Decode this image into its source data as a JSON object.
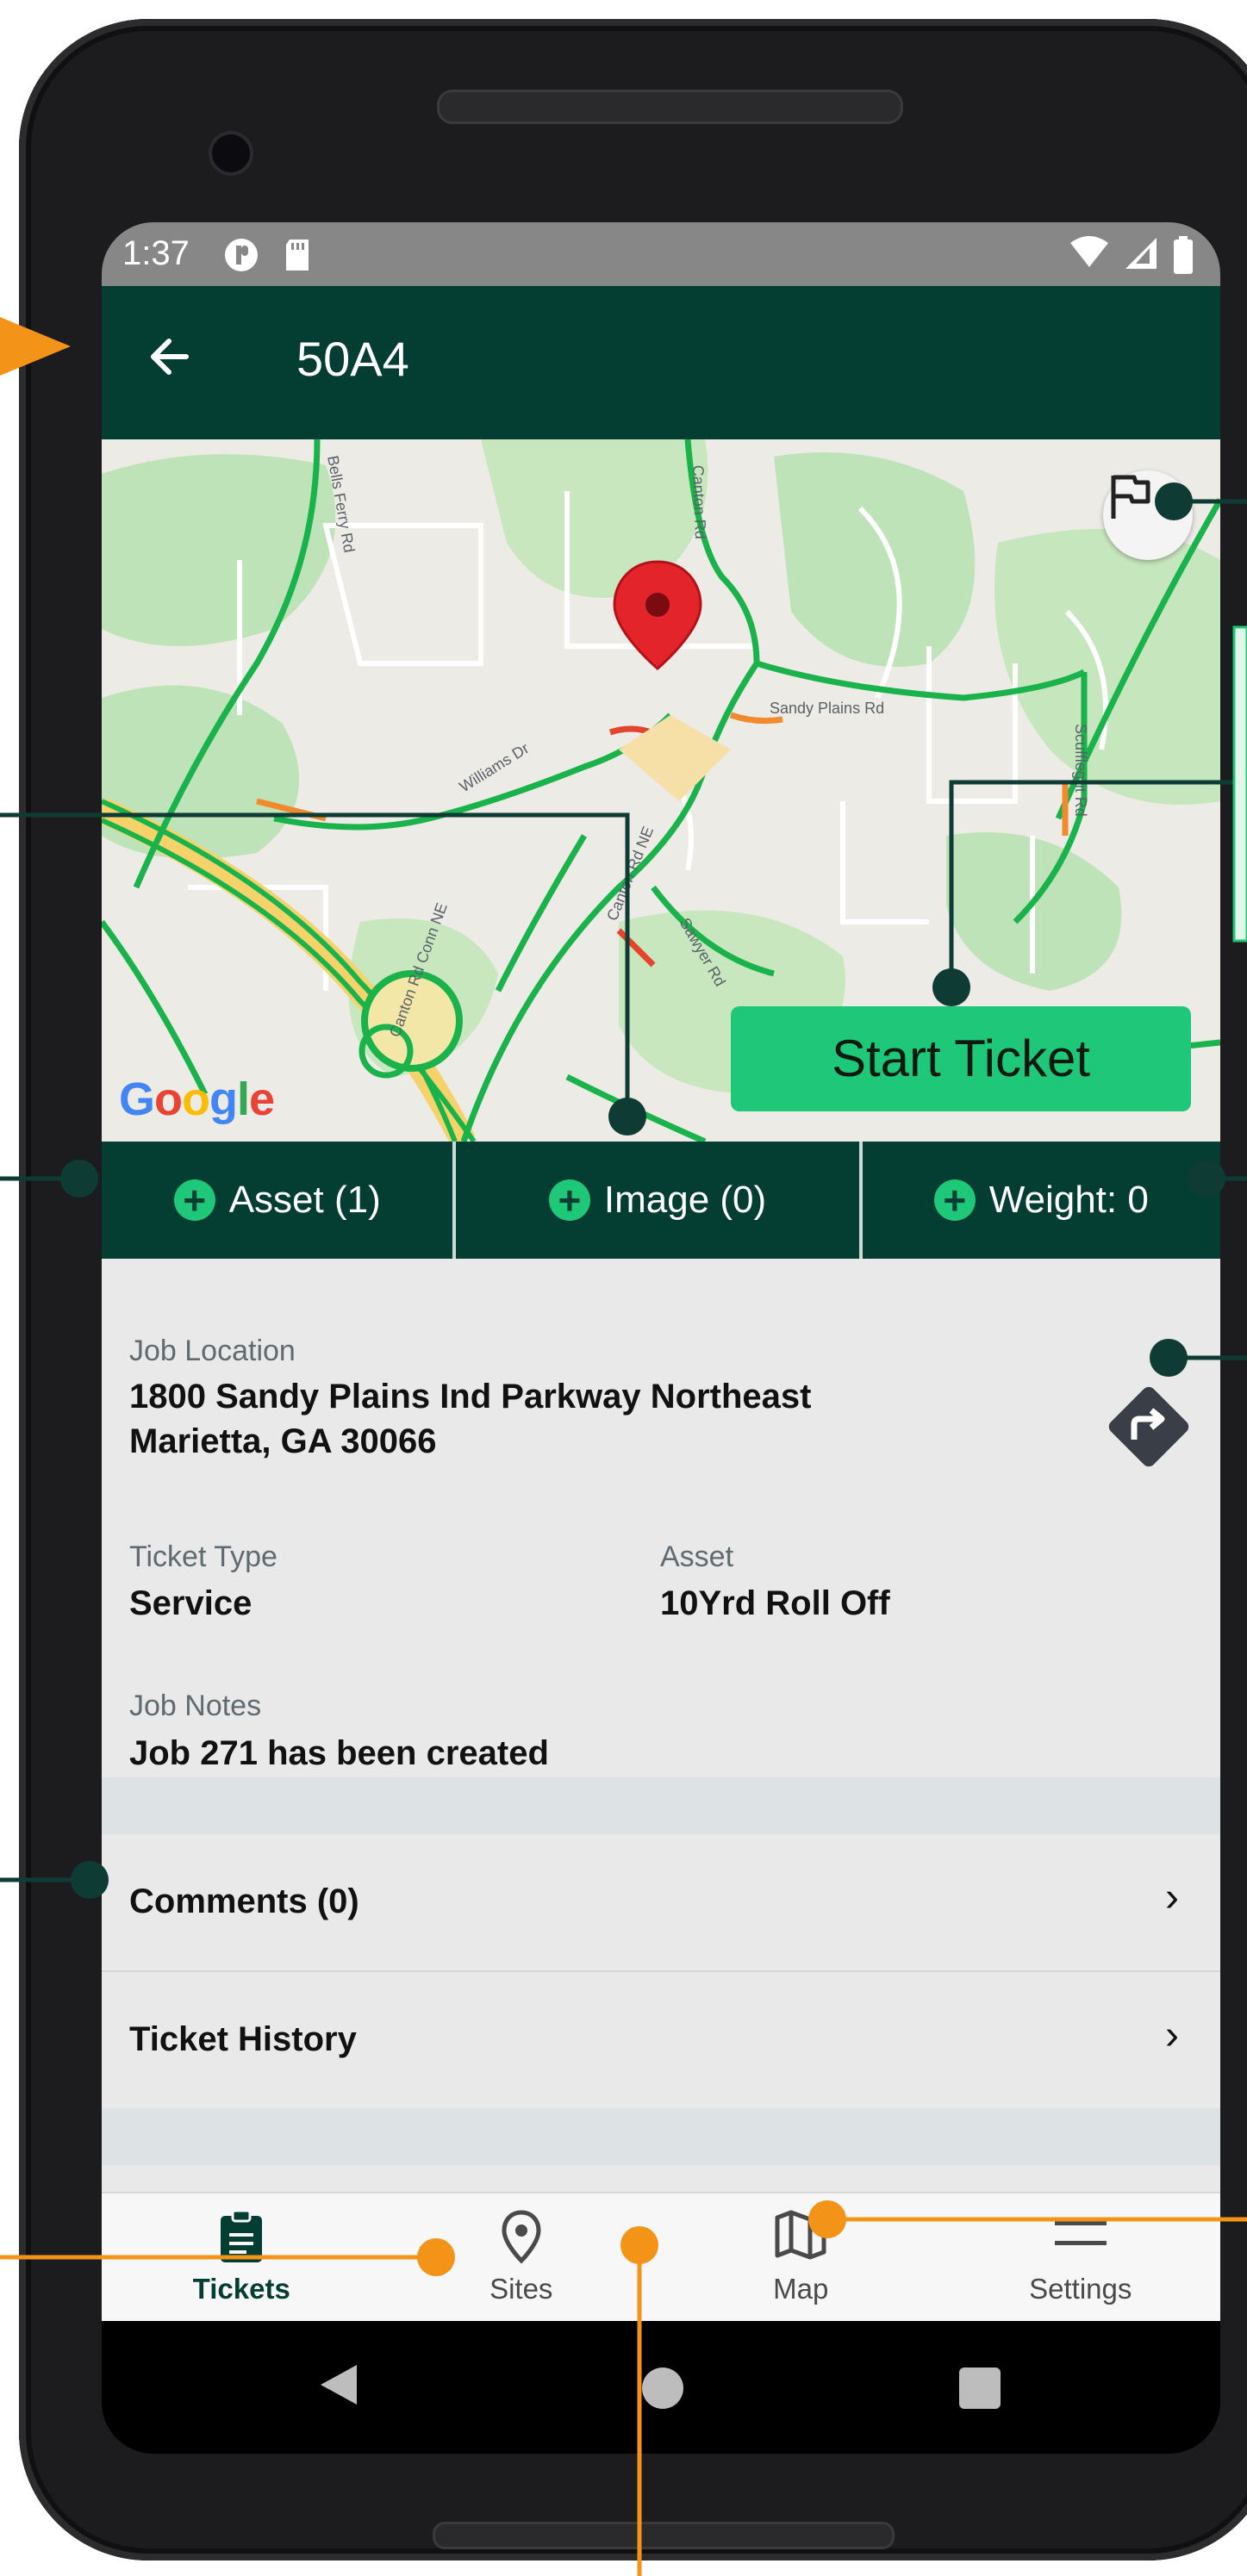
{
  "status": {
    "time": "1:37"
  },
  "appbar": {
    "title": "50A4"
  },
  "map": {
    "start_ticket_label": "Start Ticket",
    "google_letters": [
      "G",
      "o",
      "o",
      "g",
      "l",
      "e"
    ],
    "google_colors": [
      "#4285F4",
      "#EA4335",
      "#FBBC05",
      "#4285F4",
      "#34A853",
      "#EA4335"
    ],
    "road_labels": [
      "Bells Ferry Rd",
      "Canton Rd",
      "Williams Dr",
      "Sandy Plains Rd",
      "Scufflegrit Rd",
      "Canton Rd Conn NE",
      "Canton Rd NE",
      "Sawyer Rd"
    ]
  },
  "tabs": [
    {
      "label": "Asset (1)"
    },
    {
      "label": "Image (0)"
    },
    {
      "label": "Weight: 0"
    }
  ],
  "details": {
    "job_location_label": "Job Location",
    "address_line1": "1800 Sandy Plains Ind Parkway Northeast",
    "address_line2": "Marietta, GA 30066",
    "ticket_type_label": "Ticket Type",
    "ticket_type_value": "Service",
    "asset_label": "Asset",
    "asset_value": "10Yrd Roll Off",
    "job_notes_label": "Job Notes",
    "job_notes_value": "Job 271 has been created"
  },
  "rows": {
    "comments": "Comments (0)",
    "ticket_history": "Ticket History"
  },
  "bottom_nav": [
    {
      "label": "Tickets",
      "icon": "clipboard-icon"
    },
    {
      "label": "Sites",
      "icon": "location-pin-icon"
    },
    {
      "label": "Map",
      "icon": "map-icon"
    },
    {
      "label": "Settings",
      "icon": "menu-icon"
    }
  ],
  "colors": {
    "appbar": "#043d32",
    "accent_green": "#1ec878",
    "callout_dark": "#0e3b33",
    "callout_orange": "#f39419"
  }
}
